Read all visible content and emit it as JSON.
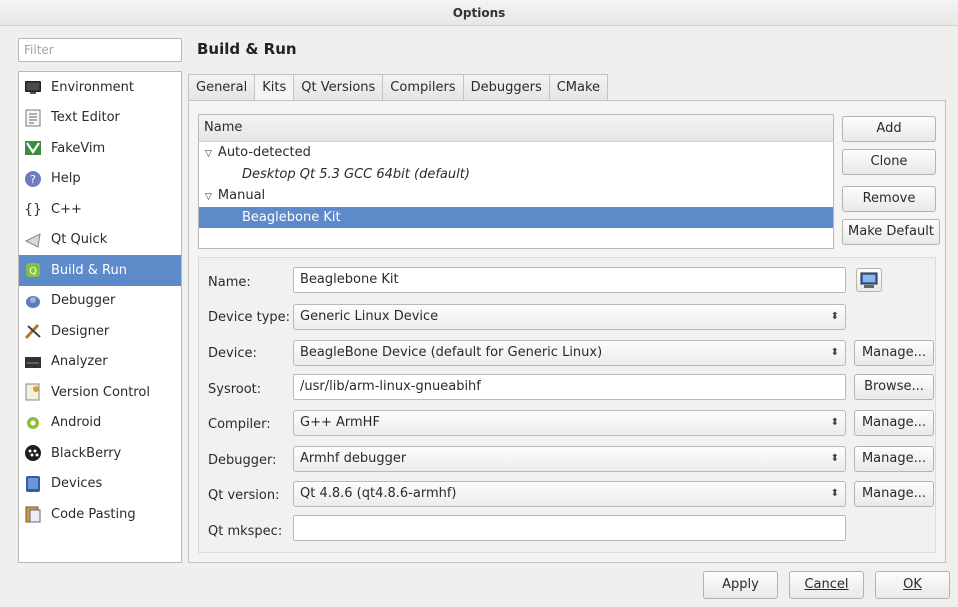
{
  "window": {
    "title": "Options"
  },
  "filter": {
    "placeholder": "Filter"
  },
  "sidebar": {
    "items": [
      {
        "label": "Environment",
        "icon": "monitor-icon"
      },
      {
        "label": "Text Editor",
        "icon": "text-document-icon"
      },
      {
        "label": "FakeVim",
        "icon": "fakevim-icon"
      },
      {
        "label": "Help",
        "icon": "help-icon"
      },
      {
        "label": "C++",
        "icon": "braces-icon"
      },
      {
        "label": "Qt Quick",
        "icon": "qt-quick-icon"
      },
      {
        "label": "Build & Run",
        "icon": "build-run-icon",
        "selected": true
      },
      {
        "label": "Debugger",
        "icon": "debugger-icon"
      },
      {
        "label": "Designer",
        "icon": "designer-icon"
      },
      {
        "label": "Analyzer",
        "icon": "analyzer-icon"
      },
      {
        "label": "Version Control",
        "icon": "version-control-icon"
      },
      {
        "label": "Android",
        "icon": "android-icon"
      },
      {
        "label": "BlackBerry",
        "icon": "blackberry-icon"
      },
      {
        "label": "Devices",
        "icon": "devices-icon"
      },
      {
        "label": "Code Pasting",
        "icon": "code-pasting-icon"
      }
    ]
  },
  "page": {
    "title": "Build & Run"
  },
  "tabs": [
    {
      "label": "General"
    },
    {
      "label": "Kits",
      "active": true
    },
    {
      "label": "Qt Versions"
    },
    {
      "label": "Compilers"
    },
    {
      "label": "Debuggers"
    },
    {
      "label": "CMake"
    }
  ],
  "kits": {
    "header": "Name",
    "auto_group": "Auto-detected",
    "auto_kit": "Desktop Qt 5.3 GCC 64bit (default)",
    "manual_group": "Manual",
    "manual_kit": "Beaglebone Kit"
  },
  "kit_buttons": {
    "add": "Add",
    "clone": "Clone",
    "remove": "Remove",
    "make_default": "Make Default"
  },
  "form": {
    "name_label": "Name:",
    "name_value": "Beaglebone Kit",
    "device_type_label": "Device type:",
    "device_type_value": "Generic Linux Device",
    "device_label": "Device:",
    "device_value": "BeagleBone Device (default for Generic Linux)",
    "sysroot_label": "Sysroot:",
    "sysroot_value": "/usr/lib/arm-linux-gnueabihf",
    "compiler_label": "Compiler:",
    "compiler_value": "G++ ArmHF",
    "debugger_label": "Debugger:",
    "debugger_value": "Armhf debugger",
    "qt_version_label": "Qt version:",
    "qt_version_value": "Qt 4.8.6 (qt4.8.6-armhf)",
    "mkspec_label": "Qt mkspec:",
    "mkspec_value": "",
    "manage": "Manage...",
    "browse": "Browse..."
  },
  "footer": {
    "apply": "Apply",
    "cancel": "Cancel",
    "ok": "OK"
  },
  "colors": {
    "selection": "#5d8ac9",
    "background": "#efefee"
  }
}
